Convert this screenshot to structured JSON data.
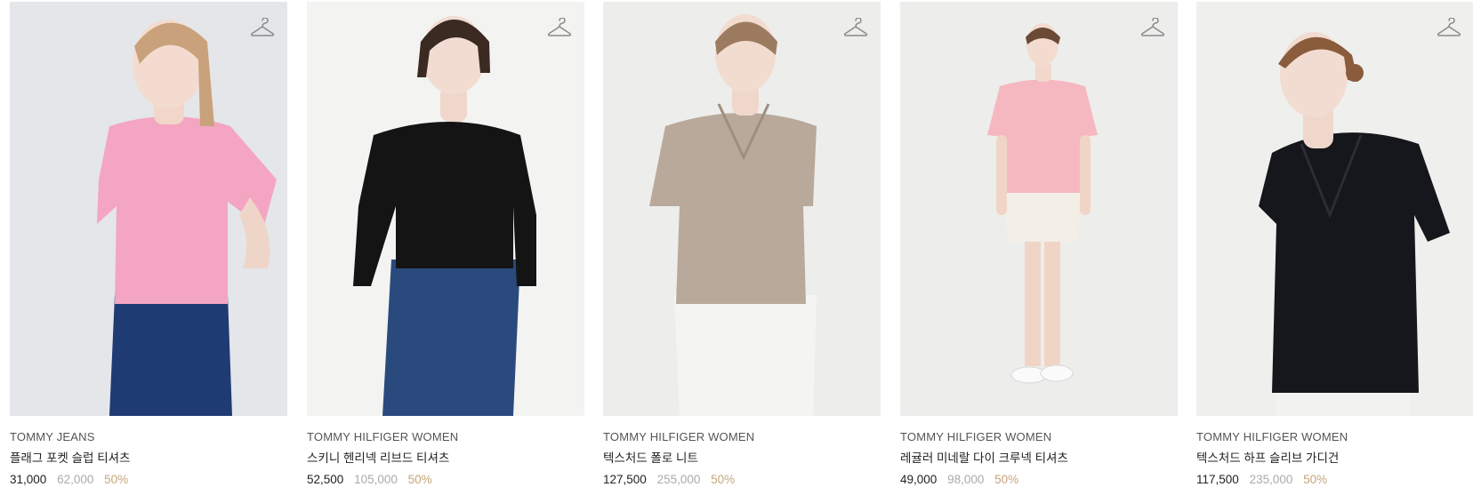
{
  "products": [
    {
      "brand": "TOMMY JEANS",
      "name": "플래그 포켓 슬럽 티셔츠",
      "price": "31,000",
      "original_price": "62,000",
      "discount": "50%",
      "top_color": "#f4a5c2",
      "bottom_color": "#1f3b73",
      "bg_color": "#e4e6ea",
      "icon": "hanger-icon"
    },
    {
      "brand": "TOMMY HILFIGER WOMEN",
      "name": "스키니 헨리넥 리브드 티셔츠",
      "price": "52,500",
      "original_price": "105,000",
      "discount": "50%",
      "top_color": "#141414",
      "bottom_color": "#2a4a7e",
      "bg_color": "#f3f3f1",
      "icon": "hanger-icon"
    },
    {
      "brand": "TOMMY HILFIGER WOMEN",
      "name": "텍스처드 폴로 니트",
      "price": "127,500",
      "original_price": "255,000",
      "discount": "50%",
      "top_color": "#b8a99a",
      "bottom_color": "#f4f4f2",
      "bg_color": "#ededeb",
      "icon": "hanger-icon"
    },
    {
      "brand": "TOMMY HILFIGER WOMEN",
      "name": "레귤러 미네랄 다이 크루넥 티셔츠",
      "price": "49,000",
      "original_price": "98,000",
      "discount": "50%",
      "top_color": "#f6b8c0",
      "bottom_color": "#f3efe6",
      "bg_color": "#ededec",
      "icon": "hanger-icon"
    },
    {
      "brand": "TOMMY HILFIGER WOMEN",
      "name": "텍스처드 하프 슬리브 가디건",
      "price": "117,500",
      "original_price": "235,000",
      "discount": "50%",
      "top_color": "#15171c",
      "bottom_color": "#f2f2f0",
      "bg_color": "#efefed",
      "icon": "hanger-icon"
    }
  ]
}
